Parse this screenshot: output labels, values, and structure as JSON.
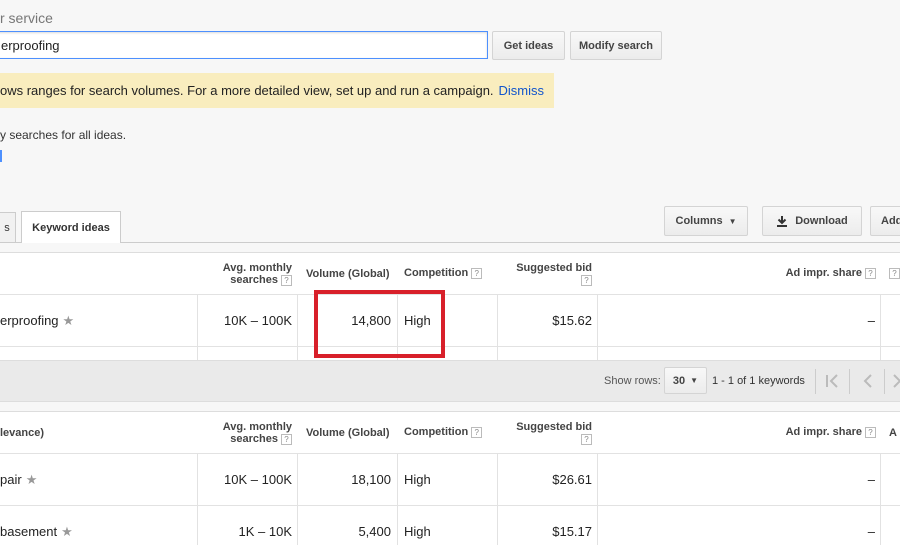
{
  "form": {
    "field_label": "r service",
    "search_value": "erproofing",
    "get_ideas": "Get ideas",
    "modify_search": "Modify search"
  },
  "notice": {
    "text": "ows ranges for search volumes. For a more detailed view, set up and run a campaign.",
    "dismiss": "Dismiss"
  },
  "sub_text": "y searches for all ideas.",
  "tabs": [
    {
      "label": "s",
      "active": false
    },
    {
      "label": "Keyword ideas",
      "active": true
    }
  ],
  "toolbar": {
    "columns": "Columns",
    "download": "Download",
    "add": "Add"
  },
  "headers": {
    "avg_monthly": [
      "Avg. monthly",
      "searches"
    ],
    "volume": "Volume (Global)",
    "competition": "Competition",
    "suggested_bid": "Suggested bid",
    "ad_impr": "Ad impr. share",
    "keyword_col_bottom": "levance)",
    "next_col": "A"
  },
  "top_table": {
    "rows": [
      {
        "keyword": "erproofing",
        "avg": "10K – 100K",
        "volume": "14,800",
        "competition": "High",
        "bid": "$15.62",
        "impr": "–"
      }
    ]
  },
  "pager": {
    "show_rows_label": "Show rows:",
    "rows_value": "30",
    "range": "1 - 1 of 1 keywords"
  },
  "bottom_table": {
    "rows": [
      {
        "keyword": "pair",
        "avg": "10K – 100K",
        "volume": "18,100",
        "competition": "High",
        "bid": "$26.61",
        "impr": "–"
      },
      {
        "keyword": "basement",
        "avg": "1K – 10K",
        "volume": "5,400",
        "competition": "High",
        "bid": "$15.17",
        "impr": "–"
      }
    ]
  },
  "colors": {
    "highlight": "#d8202a",
    "notice_bg": "#f9edbe",
    "link": "#1155cc"
  }
}
